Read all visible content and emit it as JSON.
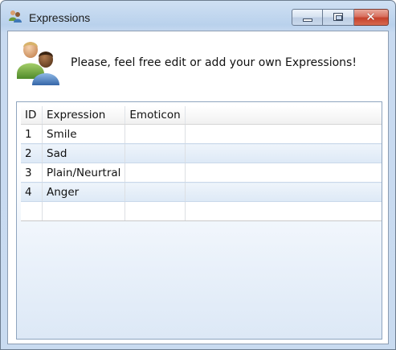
{
  "window": {
    "title": "Expressions",
    "icon": "people-icon",
    "controls": {
      "minimize": "minimize-icon",
      "maximize": "maximize-icon",
      "close": "close-icon",
      "close_glyph": "✕"
    }
  },
  "header": {
    "icon": "users-icon",
    "message": "Please, feel free edit or add your own Expressions!"
  },
  "grid": {
    "columns": [
      "ID",
      "Expression",
      "Emoticon"
    ],
    "rows": [
      {
        "id": "1",
        "expression": "Smile",
        "emoticon": ""
      },
      {
        "id": "2",
        "expression": "Sad",
        "emoticon": ""
      },
      {
        "id": "3",
        "expression": "Plain/Neurtral",
        "emoticon": ""
      },
      {
        "id": "4",
        "expression": "Anger",
        "emoticon": ""
      }
    ]
  },
  "colors": {
    "title_bar": "#c2d6ee",
    "close_button": "#c5412b",
    "grid_border": "#8fa5bf",
    "row_alt": "#e3edf8"
  }
}
